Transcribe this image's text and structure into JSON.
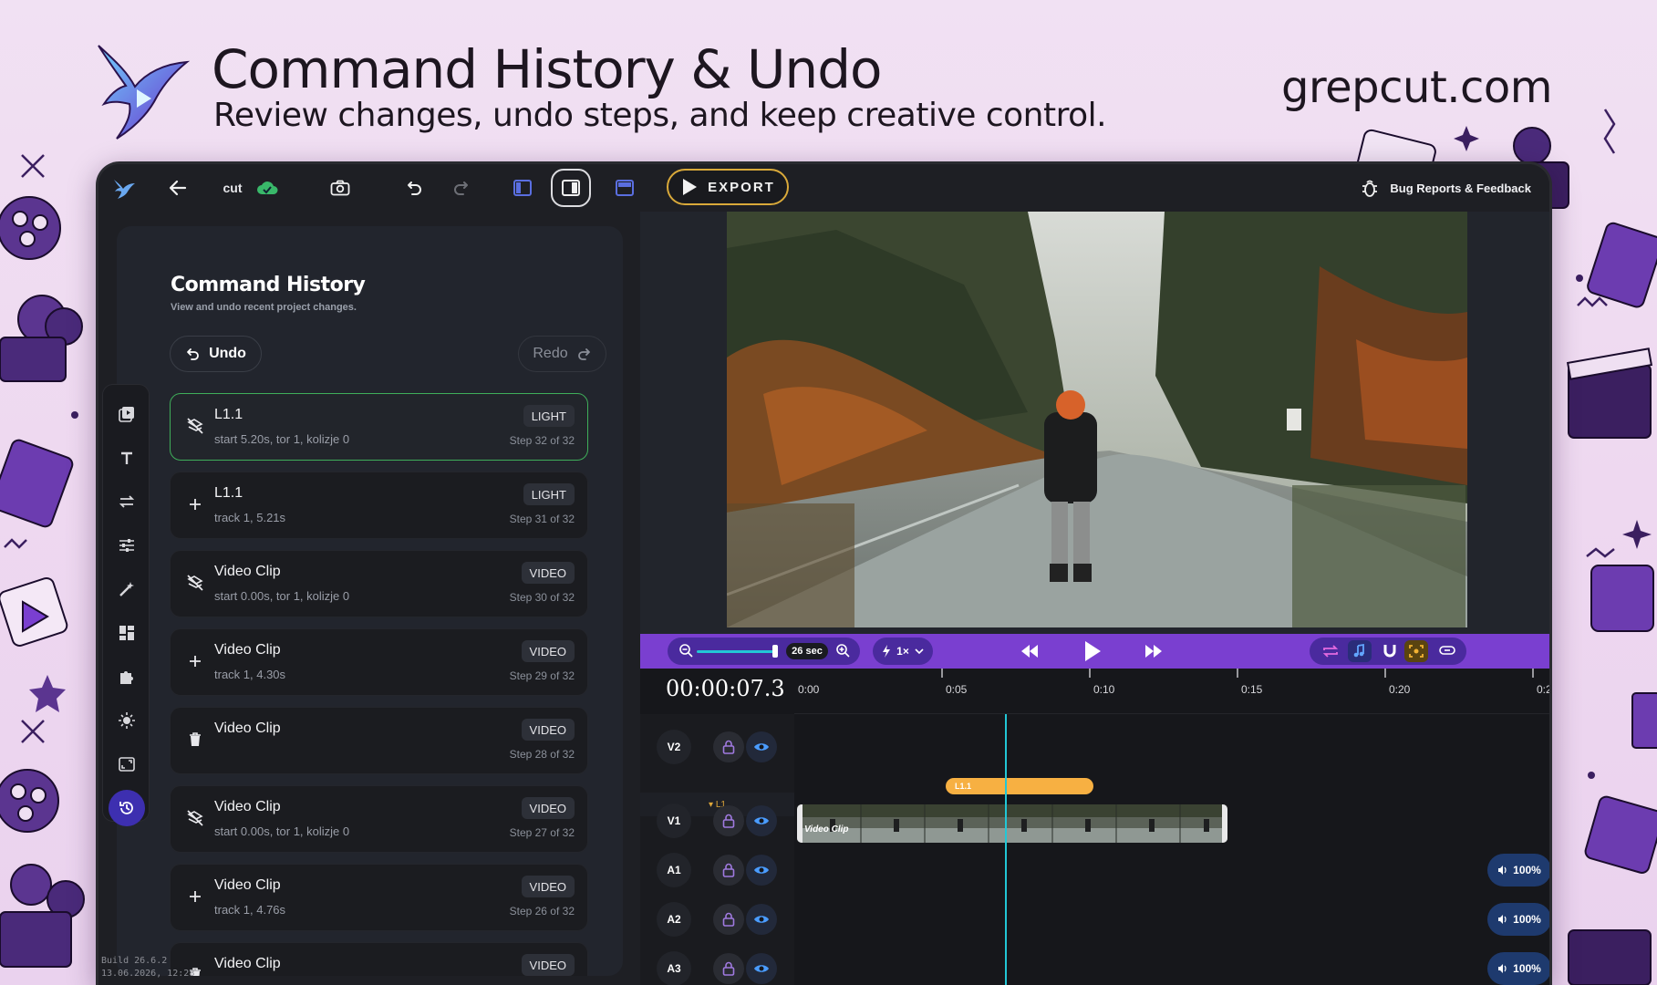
{
  "header": {
    "title": "Command History & Undo",
    "subtitle": "Review changes, undo steps, and keep creative control.",
    "site": "grepcut.com"
  },
  "topbar": {
    "project_name": "cut",
    "export_label": "EXPORT",
    "feedback_label": "Bug Reports & Feedback"
  },
  "history_panel": {
    "title": "Command History",
    "subtitle": "View and undo recent project changes.",
    "undo_label": "Undo",
    "redo_label": "Redo",
    "items": [
      {
        "icon": "unlink",
        "title": "L1.1",
        "desc": "start 5.20s, tor 1, kolizje 0",
        "badge": "LIGHT",
        "step": "Step 32 of 32",
        "current": true
      },
      {
        "icon": "plus",
        "title": "L1.1",
        "desc": "track 1, 5.21s",
        "badge": "LIGHT",
        "step": "Step 31 of 32",
        "current": false
      },
      {
        "icon": "unlink",
        "title": "Video Clip",
        "desc": "start 0.00s, tor 1, kolizje 0",
        "badge": "VIDEO",
        "step": "Step 30 of 32",
        "current": false
      },
      {
        "icon": "plus",
        "title": "Video Clip",
        "desc": "track 1, 4.30s",
        "badge": "VIDEO",
        "step": "Step 29 of 32",
        "current": false
      },
      {
        "icon": "trash",
        "title": "Video Clip",
        "desc": "",
        "badge": "VIDEO",
        "step": "Step 28 of 32",
        "current": false
      },
      {
        "icon": "unlink",
        "title": "Video Clip",
        "desc": "start 0.00s, tor 1, kolizje 0",
        "badge": "VIDEO",
        "step": "Step 27 of 32",
        "current": false
      },
      {
        "icon": "plus",
        "title": "Video Clip",
        "desc": "track 1, 4.76s",
        "badge": "VIDEO",
        "step": "Step 26 of 32",
        "current": false
      },
      {
        "icon": "trash",
        "title": "Video Clip",
        "desc": "",
        "badge": "VIDEO",
        "step": "",
        "current": false
      }
    ]
  },
  "build": {
    "line1": "Build 26.6.2",
    "line2": "13.06.2026, 12:28"
  },
  "timeline": {
    "zoom_label": "26 sec",
    "speed_label": "1×",
    "timecode": "00:00:07.3",
    "ruler_marks": [
      "0:00",
      "0:05",
      "0:10",
      "0:15",
      "0:20",
      "0:2"
    ],
    "group_label": "▾ L1",
    "light_clip_label": "L1.1",
    "video_clip_label": "Video Clip",
    "tracks": [
      "V2",
      "V1",
      "A1",
      "A2",
      "A3"
    ],
    "volumes": [
      "100%",
      "100%",
      "100%"
    ]
  },
  "colors": {
    "accent_purple": "#7a3fd0",
    "export_border": "#d9a93a",
    "current_border": "#3fae5a",
    "playhead": "#22c7d6",
    "light_clip": "#f7b042"
  }
}
